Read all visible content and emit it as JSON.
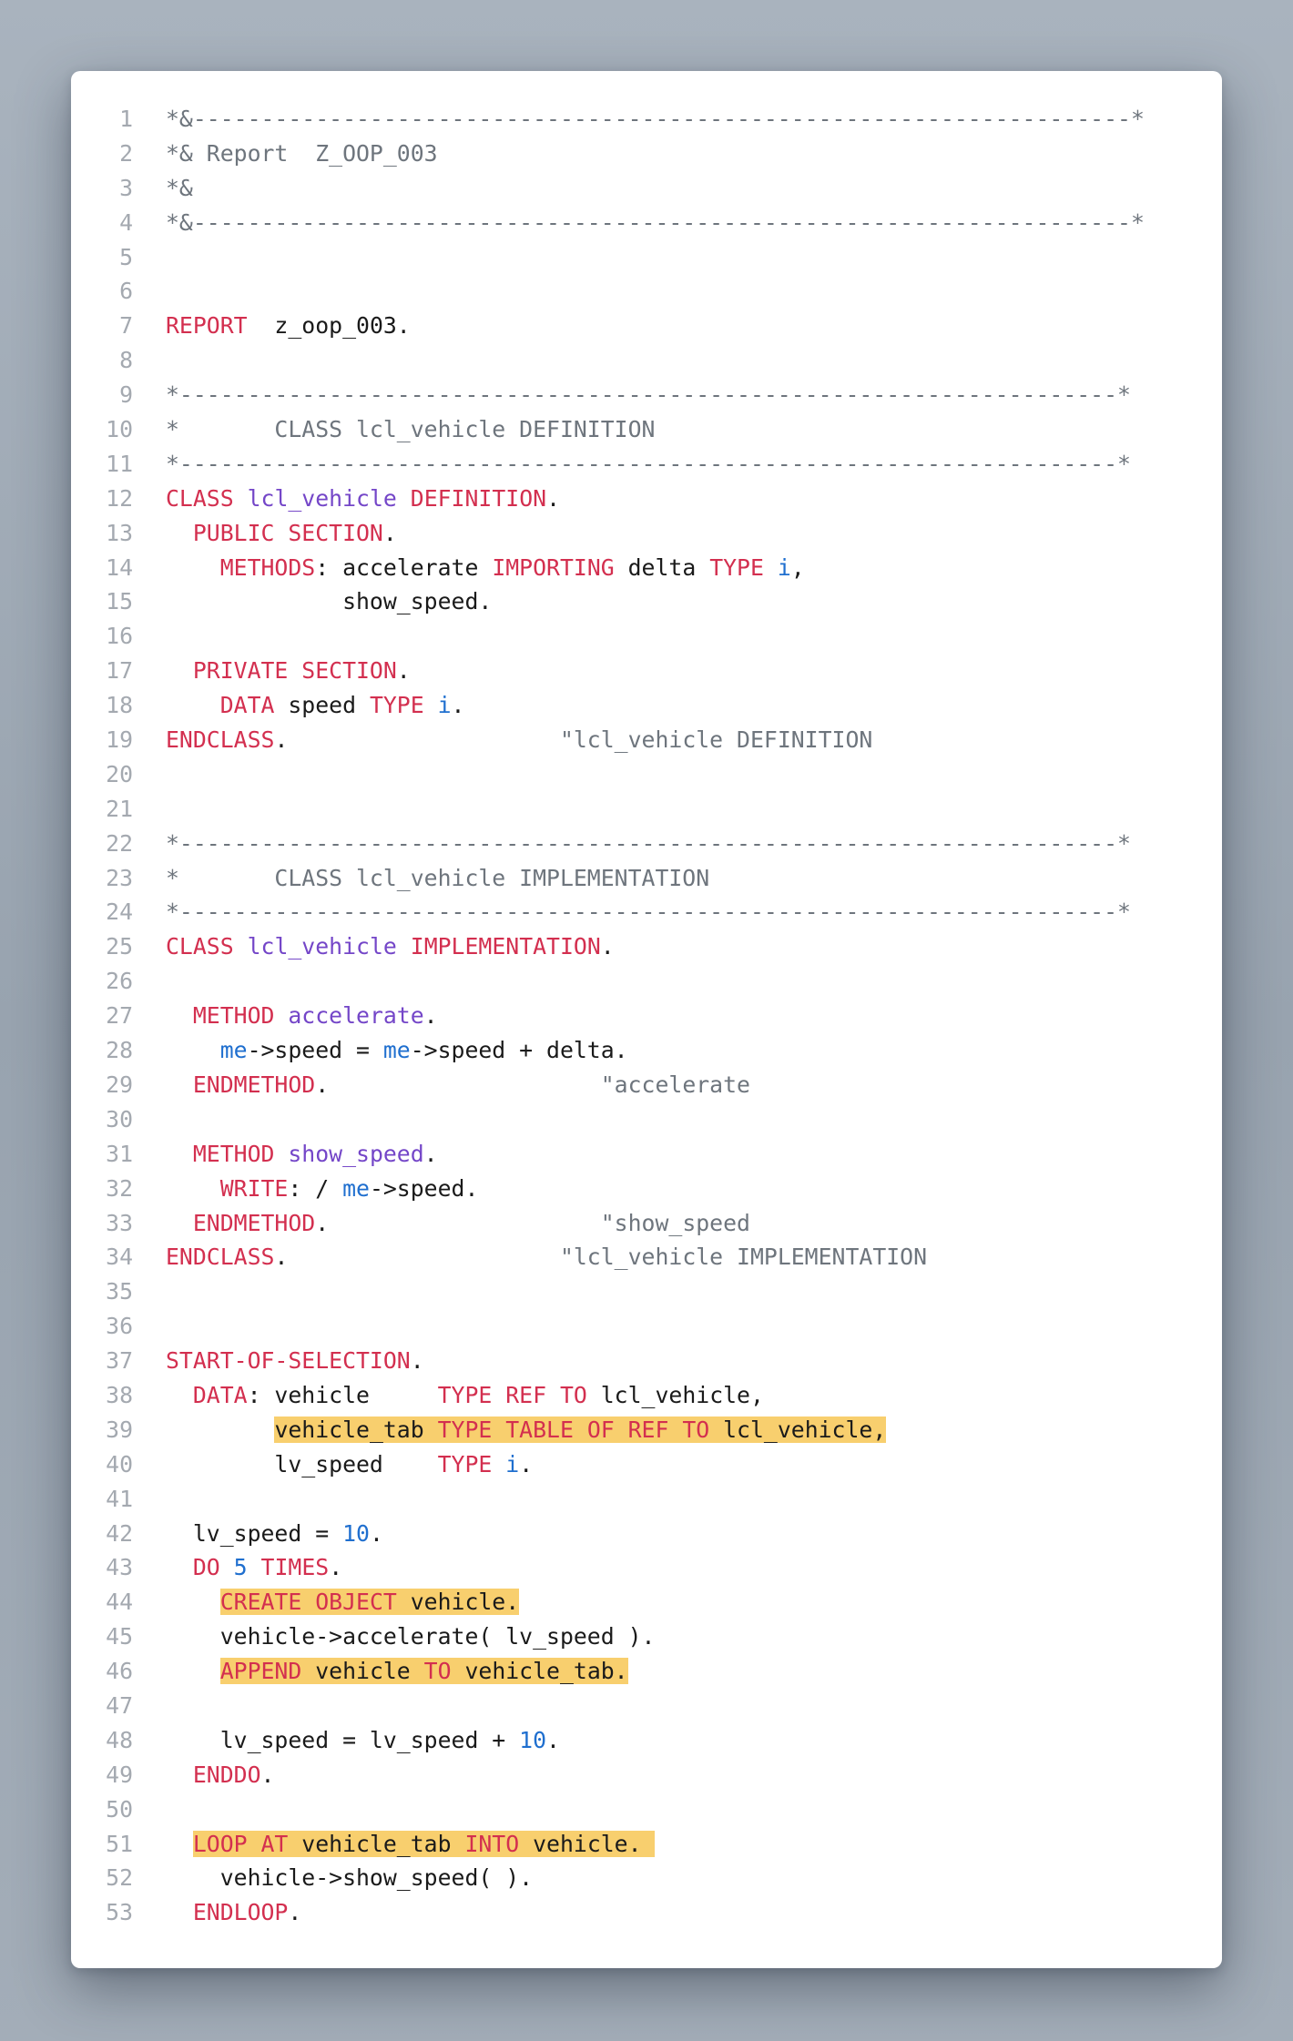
{
  "code": {
    "lines": [
      {
        "n": "1",
        "tokens": [
          {
            "t": "*&---------------------------------------------------------------------*",
            "c": "c"
          }
        ]
      },
      {
        "n": "2",
        "tokens": [
          {
            "t": "*& Report  Z_OOP_003",
            "c": "c"
          }
        ]
      },
      {
        "n": "3",
        "tokens": [
          {
            "t": "*&",
            "c": "c"
          }
        ]
      },
      {
        "n": "4",
        "tokens": [
          {
            "t": "*&---------------------------------------------------------------------*",
            "c": "c"
          }
        ]
      },
      {
        "n": "5",
        "tokens": []
      },
      {
        "n": "6",
        "tokens": []
      },
      {
        "n": "7",
        "tokens": [
          {
            "t": "REPORT",
            "c": "k"
          },
          {
            "t": "  z_oop_003."
          }
        ]
      },
      {
        "n": "8",
        "tokens": []
      },
      {
        "n": "9",
        "tokens": [
          {
            "t": "*---------------------------------------------------------------------*",
            "c": "c"
          }
        ]
      },
      {
        "n": "10",
        "tokens": [
          {
            "t": "*       CLASS lcl_vehicle DEFINITION",
            "c": "c"
          }
        ]
      },
      {
        "n": "11",
        "tokens": [
          {
            "t": "*---------------------------------------------------------------------*",
            "c": "c"
          }
        ]
      },
      {
        "n": "12",
        "tokens": [
          {
            "t": "CLASS",
            "c": "k"
          },
          {
            "t": " "
          },
          {
            "t": "lcl_vehicle",
            "c": "p"
          },
          {
            "t": " "
          },
          {
            "t": "DEFINITION",
            "c": "k"
          },
          {
            "t": "."
          }
        ]
      },
      {
        "n": "13",
        "tokens": [
          {
            "t": "  "
          },
          {
            "t": "PUBLIC SECTION",
            "c": "k"
          },
          {
            "t": "."
          }
        ]
      },
      {
        "n": "14",
        "tokens": [
          {
            "t": "    "
          },
          {
            "t": "METHODS",
            "c": "k"
          },
          {
            "t": ": accelerate "
          },
          {
            "t": "IMPORTING",
            "c": "k"
          },
          {
            "t": " delta "
          },
          {
            "t": "TYPE",
            "c": "k"
          },
          {
            "t": " "
          },
          {
            "t": "i",
            "c": "n"
          },
          {
            "t": ","
          }
        ]
      },
      {
        "n": "15",
        "tokens": [
          {
            "t": "             show_speed."
          }
        ]
      },
      {
        "n": "16",
        "tokens": []
      },
      {
        "n": "17",
        "tokens": [
          {
            "t": "  "
          },
          {
            "t": "PRIVATE SECTION",
            "c": "k"
          },
          {
            "t": "."
          }
        ]
      },
      {
        "n": "18",
        "tokens": [
          {
            "t": "    "
          },
          {
            "t": "DATA",
            "c": "k"
          },
          {
            "t": " speed "
          },
          {
            "t": "TYPE",
            "c": "k"
          },
          {
            "t": " "
          },
          {
            "t": "i",
            "c": "n"
          },
          {
            "t": "."
          }
        ]
      },
      {
        "n": "19",
        "tokens": [
          {
            "t": "ENDCLASS",
            "c": "k"
          },
          {
            "t": ".                    "
          },
          {
            "t": "\"lcl_vehicle DEFINITION",
            "c": "c"
          }
        ]
      },
      {
        "n": "20",
        "tokens": []
      },
      {
        "n": "21",
        "tokens": []
      },
      {
        "n": "22",
        "tokens": [
          {
            "t": "*---------------------------------------------------------------------*",
            "c": "c"
          }
        ]
      },
      {
        "n": "23",
        "tokens": [
          {
            "t": "*       CLASS lcl_vehicle IMPLEMENTATION",
            "c": "c"
          }
        ]
      },
      {
        "n": "24",
        "tokens": [
          {
            "t": "*---------------------------------------------------------------------*",
            "c": "c"
          }
        ]
      },
      {
        "n": "25",
        "tokens": [
          {
            "t": "CLASS",
            "c": "k"
          },
          {
            "t": " "
          },
          {
            "t": "lcl_vehicle",
            "c": "p"
          },
          {
            "t": " "
          },
          {
            "t": "IMPLEMENTATION",
            "c": "k"
          },
          {
            "t": "."
          }
        ]
      },
      {
        "n": "26",
        "tokens": []
      },
      {
        "n": "27",
        "tokens": [
          {
            "t": "  "
          },
          {
            "t": "METHOD",
            "c": "k"
          },
          {
            "t": " "
          },
          {
            "t": "accelerate",
            "c": "p"
          },
          {
            "t": "."
          }
        ]
      },
      {
        "n": "28",
        "tokens": [
          {
            "t": "    "
          },
          {
            "t": "me",
            "c": "n"
          },
          {
            "t": "->speed = "
          },
          {
            "t": "me",
            "c": "n"
          },
          {
            "t": "->speed + delta."
          }
        ]
      },
      {
        "n": "29",
        "tokens": [
          {
            "t": "  "
          },
          {
            "t": "ENDMETHOD",
            "c": "k"
          },
          {
            "t": ".                    "
          },
          {
            "t": "\"accelerate",
            "c": "c"
          }
        ]
      },
      {
        "n": "30",
        "tokens": []
      },
      {
        "n": "31",
        "tokens": [
          {
            "t": "  "
          },
          {
            "t": "METHOD",
            "c": "k"
          },
          {
            "t": " "
          },
          {
            "t": "show_speed",
            "c": "p"
          },
          {
            "t": "."
          }
        ]
      },
      {
        "n": "32",
        "tokens": [
          {
            "t": "    "
          },
          {
            "t": "WRITE",
            "c": "k"
          },
          {
            "t": ": / "
          },
          {
            "t": "me",
            "c": "n"
          },
          {
            "t": "->speed."
          }
        ]
      },
      {
        "n": "33",
        "tokens": [
          {
            "t": "  "
          },
          {
            "t": "ENDMETHOD",
            "c": "k"
          },
          {
            "t": ".                    "
          },
          {
            "t": "\"show_speed",
            "c": "c"
          }
        ]
      },
      {
        "n": "34",
        "tokens": [
          {
            "t": "ENDCLASS",
            "c": "k"
          },
          {
            "t": ".                    "
          },
          {
            "t": "\"lcl_vehicle IMPLEMENTATION",
            "c": "c"
          }
        ]
      },
      {
        "n": "35",
        "tokens": []
      },
      {
        "n": "36",
        "tokens": []
      },
      {
        "n": "37",
        "tokens": [
          {
            "t": "START-OF-SELECTION",
            "c": "k"
          },
          {
            "t": "."
          }
        ]
      },
      {
        "n": "38",
        "tokens": [
          {
            "t": "  "
          },
          {
            "t": "DATA",
            "c": "k"
          },
          {
            "t": ": vehicle     "
          },
          {
            "t": "TYPE REF TO",
            "c": "k"
          },
          {
            "t": " lcl_vehicle,"
          }
        ]
      },
      {
        "n": "39",
        "tokens": [
          {
            "t": "        "
          },
          {
            "t": "vehicle_tab ",
            "h": true
          },
          {
            "t": "TYPE TABLE OF REF TO",
            "c": "k",
            "h": true
          },
          {
            "t": " lcl_vehicle,",
            "h": true
          }
        ]
      },
      {
        "n": "40",
        "tokens": [
          {
            "t": "        lv_speed    "
          },
          {
            "t": "TYPE",
            "c": "k"
          },
          {
            "t": " "
          },
          {
            "t": "i",
            "c": "n"
          },
          {
            "t": "."
          }
        ]
      },
      {
        "n": "41",
        "tokens": []
      },
      {
        "n": "42",
        "tokens": [
          {
            "t": "  lv_speed = "
          },
          {
            "t": "10",
            "c": "n"
          },
          {
            "t": "."
          }
        ]
      },
      {
        "n": "43",
        "tokens": [
          {
            "t": "  "
          },
          {
            "t": "DO",
            "c": "k"
          },
          {
            "t": " "
          },
          {
            "t": "5",
            "c": "n"
          },
          {
            "t": " "
          },
          {
            "t": "TIMES",
            "c": "k"
          },
          {
            "t": "."
          }
        ]
      },
      {
        "n": "44",
        "tokens": [
          {
            "t": "    "
          },
          {
            "t": "CREATE OBJECT",
            "c": "k",
            "h": true
          },
          {
            "t": " vehicle.",
            "h": true
          }
        ]
      },
      {
        "n": "45",
        "tokens": [
          {
            "t": "    vehicle->accelerate( lv_speed )."
          }
        ]
      },
      {
        "n": "46",
        "tokens": [
          {
            "t": "    "
          },
          {
            "t": "APPEND",
            "c": "k",
            "h": true
          },
          {
            "t": " vehicle ",
            "h": true
          },
          {
            "t": "TO",
            "c": "k",
            "h": true
          },
          {
            "t": " vehicle_tab.",
            "h": true
          }
        ]
      },
      {
        "n": "47",
        "tokens": []
      },
      {
        "n": "48",
        "tokens": [
          {
            "t": "    lv_speed = lv_speed + "
          },
          {
            "t": "10",
            "c": "n"
          },
          {
            "t": "."
          }
        ]
      },
      {
        "n": "49",
        "tokens": [
          {
            "t": "  "
          },
          {
            "t": "ENDDO",
            "c": "k"
          },
          {
            "t": "."
          }
        ]
      },
      {
        "n": "50",
        "tokens": []
      },
      {
        "n": "51",
        "tokens": [
          {
            "t": "  "
          },
          {
            "t": "LOOP AT",
            "c": "k",
            "h": true
          },
          {
            "t": " vehicle_tab ",
            "h": true
          },
          {
            "t": "INTO",
            "c": "k",
            "h": true
          },
          {
            "t": " vehicle. ",
            "h": true
          }
        ]
      },
      {
        "n": "52",
        "tokens": [
          {
            "t": "    vehicle->show_speed( )."
          }
        ]
      },
      {
        "n": "53",
        "tokens": [
          {
            "t": "  "
          },
          {
            "t": "ENDLOOP",
            "c": "k"
          },
          {
            "t": "."
          }
        ]
      }
    ]
  }
}
